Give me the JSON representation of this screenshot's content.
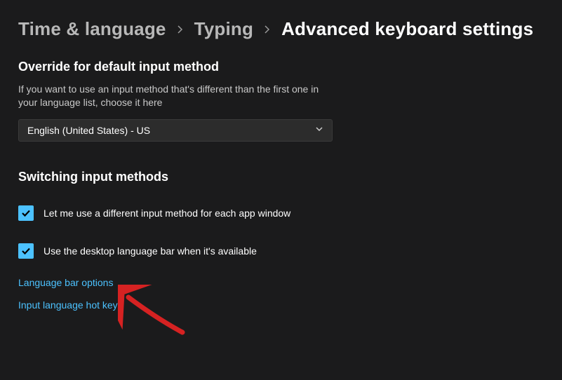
{
  "breadcrumb": {
    "items": [
      {
        "label": "Time & language"
      },
      {
        "label": "Typing"
      },
      {
        "label": "Advanced keyboard settings"
      }
    ]
  },
  "override": {
    "title": "Override for default input method",
    "desc": "If you want to use an input method that's different than the first one in your language list, choose it here",
    "selected": "English (United States) - US"
  },
  "switching": {
    "title": "Switching input methods",
    "cb1_label": "Let me use a different input method for each app window",
    "cb2_label": "Use the desktop language bar when it's available"
  },
  "links": {
    "lang_bar": "Language bar options",
    "hotkeys": "Input language hot keys"
  },
  "colors": {
    "accent": "#4cc2ff"
  }
}
